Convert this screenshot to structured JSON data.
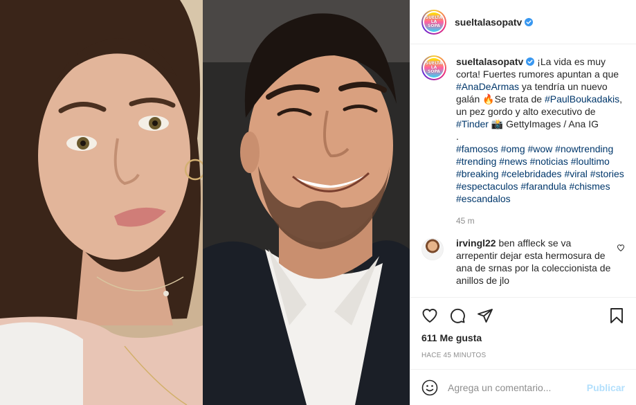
{
  "post": {
    "username": "sueltalasopatv",
    "avatar_logo_lines": [
      "SUELTA",
      "LA",
      "SOPA"
    ],
    "caption": {
      "username": "sueltalasopatv",
      "part1": "¡La vida es muy corta! Fuertes rumores apuntan a que ",
      "tag1": "#AnaDeArmas",
      "part2": " ya tendría un nuevo galán 🔥Se trata de ",
      "tag2": "#PaulBoukadakis",
      "part3": ", un pez gordo y alto executivo de ",
      "tag3": "#Tinder",
      "part4": " 📸 GettyImages / Ana IG",
      "dot": ".",
      "hashtags": "#famosos #omg #wow #nowtrending #trending #news #noticias #loultimo #breaking #celebridades #viral #stories #espectaculos #farandula #chismes #escandalos",
      "time": "45 m"
    },
    "comments": [
      {
        "username": "irvingl22",
        "text": " ben affleck se va arrepentir dejar esta hermosura de ana de srnas por la coleccionista de anillos de jlo"
      }
    ],
    "likes": "611 Me gusta",
    "posted": "HACE 45 MINUTOS",
    "add_comment": {
      "placeholder": "Agrega un comentario...",
      "publish_label": "Publicar"
    },
    "icons": {
      "like": "heart-icon",
      "comment": "comment-icon",
      "share": "share-icon",
      "save": "bookmark-icon",
      "emoji": "emoji-icon",
      "verified": "verified-badge-icon"
    },
    "colors": {
      "hashtag": "#00376b",
      "verified": "#3897f0",
      "publish_disabled": "#b2dffc",
      "muted": "#8e8e8e"
    }
  }
}
